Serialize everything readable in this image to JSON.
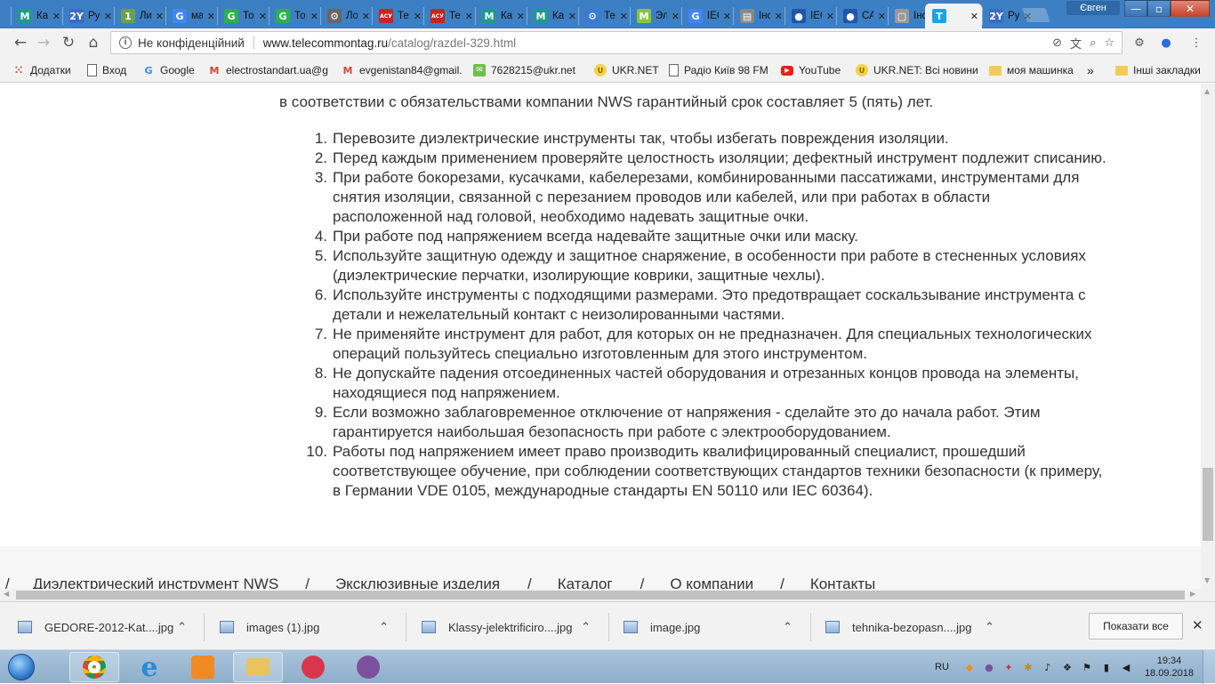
{
  "browser": {
    "tabs": [
      {
        "title": "Как",
        "icon": "M",
        "color": "#1f9b8a"
      },
      {
        "title": "Руч",
        "icon": "2Y",
        "color": "#3b6bc4"
      },
      {
        "title": "Лис",
        "icon": "1",
        "color": "#6ba14e"
      },
      {
        "title": "ма",
        "icon": "G",
        "color": "#4285f4"
      },
      {
        "title": "Тон",
        "icon": "G",
        "color": "#2bb24c"
      },
      {
        "title": "Тон",
        "icon": "G",
        "color": "#2bb24c"
      },
      {
        "title": "Лог",
        "icon": "⚙",
        "color": "#666666"
      },
      {
        "title": "Тех",
        "icon": "АСУ",
        "color": "#cc2222"
      },
      {
        "title": "Тех",
        "icon": "АСУ",
        "color": "#cc2222"
      },
      {
        "title": "Как",
        "icon": "M",
        "color": "#1f9b8a"
      },
      {
        "title": "Как",
        "icon": "M",
        "color": "#1f9b8a"
      },
      {
        "title": "Тех",
        "icon": "⚙",
        "color": "#3b78d8"
      },
      {
        "title": "Эле",
        "icon": "M",
        "color": "#8ac33e"
      },
      {
        "title": "IEC",
        "icon": "G",
        "color": "#4285f4"
      },
      {
        "title": "Інс",
        "icon": "▤",
        "color": "#888888"
      },
      {
        "title": "IEC",
        "icon": "●",
        "color": "#2255aa"
      },
      {
        "title": "CAT",
        "icon": "●",
        "color": "#2255aa"
      },
      {
        "title": "Інс",
        "icon": "▢",
        "color": "#999999"
      },
      {
        "title": "",
        "icon": "T",
        "color": "#1aa3e8",
        "active": true
      },
      {
        "title": "Руч",
        "icon": "2Y",
        "color": "#3b6bc4"
      }
    ],
    "profile_name": "Євген",
    "window_controls": {
      "minimize": "—",
      "maximize": "▫",
      "close": "✕"
    },
    "nav": {
      "back": "←",
      "forward": "→",
      "reload": "↻",
      "home": "⌂"
    },
    "address": {
      "security_label": "Не конфіденційний",
      "host": "www.telecommontag.ru",
      "path": "/catalog/razdel-329.html"
    },
    "bookmarks": [
      {
        "label": "Додатки",
        "icon": "apps-icon"
      },
      {
        "label": "Вход",
        "icon": "doc"
      },
      {
        "label": "Google",
        "icon": "G"
      },
      {
        "label": "electrostandart.ua@g",
        "icon": "M"
      },
      {
        "label": "evgenistan84@gmail.",
        "icon": "M"
      },
      {
        "label": "7628215@ukr.net",
        "icon": "mail"
      },
      {
        "label": "UKR.NET",
        "icon": "ukr"
      },
      {
        "label": "Радіо Київ 98 FM",
        "icon": "doc"
      },
      {
        "label": "YouTube",
        "icon": "yt"
      },
      {
        "label": "UKR.NET: Всі новини",
        "icon": "ukr"
      },
      {
        "label": "моя машинка",
        "icon": "folder"
      }
    ],
    "bookmarks_more": "»",
    "other_bookmarks": "Інші закладки"
  },
  "page": {
    "intro": "в соответствии с обязательствами компании NWS гарантийный срок составляет 5 (пять) лет.",
    "rules": [
      {
        "num": "1.",
        "lines": [
          "Перевозите диэлектрические инструменты так, чтобы избегать повреждения изоляции."
        ]
      },
      {
        "num": "2.",
        "lines": [
          "Перед каждым применением проверяйте целостность изоляции; дефектный инструмент подлежит списанию."
        ]
      },
      {
        "num": "3.",
        "lines": [
          "При работе бокорезами, кусачками, кабелерезами, комбинированными пассатижами, инструментами для",
          "снятия изоляции, связанной с перезанием проводов или кабелей, или при работах в области",
          "расположенной над головой, необходимо надевать защитные очки."
        ]
      },
      {
        "num": "4.",
        "lines": [
          "При работе под напряжением всегда надевайте защитные очки или маску."
        ]
      },
      {
        "num": "5.",
        "lines": [
          "Используйте защитную одежду и защитное снаряжение, в особенности при работе в стесненных условиях",
          "(диэлектрические перчатки, изолирующие коврики, защитные чехлы)."
        ]
      },
      {
        "num": "6.",
        "lines": [
          "Используйте инструменты с подходящими размерами. Это предотвращает соскальзывание инструмента с",
          "детали и нежелательный контакт с неизолированными частями."
        ]
      },
      {
        "num": "7.",
        "lines": [
          "Не применяйте инструмент для работ, для которых он не предназначен. Для специальных технологических",
          "операций пользуйтесь специально изготовленным для этого инструментом."
        ]
      },
      {
        "num": "8.",
        "lines": [
          "Не допускайте падения отсоединенных частей оборудования и отрезанных концов провода на элементы,",
          "находящиеся под напряжением."
        ]
      },
      {
        "num": "9.",
        "lines": [
          "Если возможно заблаговременное отключение от напряжения - сделайте это до начала работ. Этим",
          "гарантируется наибольшая безопасность при работе с электрооборудованием."
        ]
      },
      {
        "num": "10.",
        "lines": [
          "Работы под напряжением имеет право производить квалифицированный специалист, прошедший",
          "соответствующее обучение, при соблюдении соответствующих стандартов техники безопасности (к примеру,",
          "в Германии VDE 0105, международные стандарты EN 50110 или IEC 60364)."
        ]
      }
    ],
    "footer_nav": {
      "separator": "/",
      "items": [
        "Диэлектрический инструмент NWS",
        "Эксклюзивные изделия",
        "Каталог",
        "О компании",
        "Контакты"
      ]
    }
  },
  "downloads": {
    "items": [
      "GEDORE-2012-Kat....jpg",
      "images (1).jpg",
      "Klassy-jelektrificiro....jpg",
      "image.jpg",
      "tehnika-bezopasn....jpg"
    ],
    "caret": "⌃",
    "show_all": "Показати все",
    "close": "✕"
  },
  "taskbar": {
    "apps": [
      {
        "name": "chrome",
        "color": "#e0443a"
      },
      {
        "name": "internet-explorer",
        "color": "#2a8ad8"
      },
      {
        "name": "media-player",
        "color": "#f08a24"
      },
      {
        "name": "file-explorer",
        "color": "#e8c45a"
      },
      {
        "name": "lips-app",
        "color": "#d8364a"
      },
      {
        "name": "viber",
        "color": "#7b519d"
      }
    ],
    "lang": "RU",
    "time": "19:34",
    "date": "18.09.2018"
  }
}
